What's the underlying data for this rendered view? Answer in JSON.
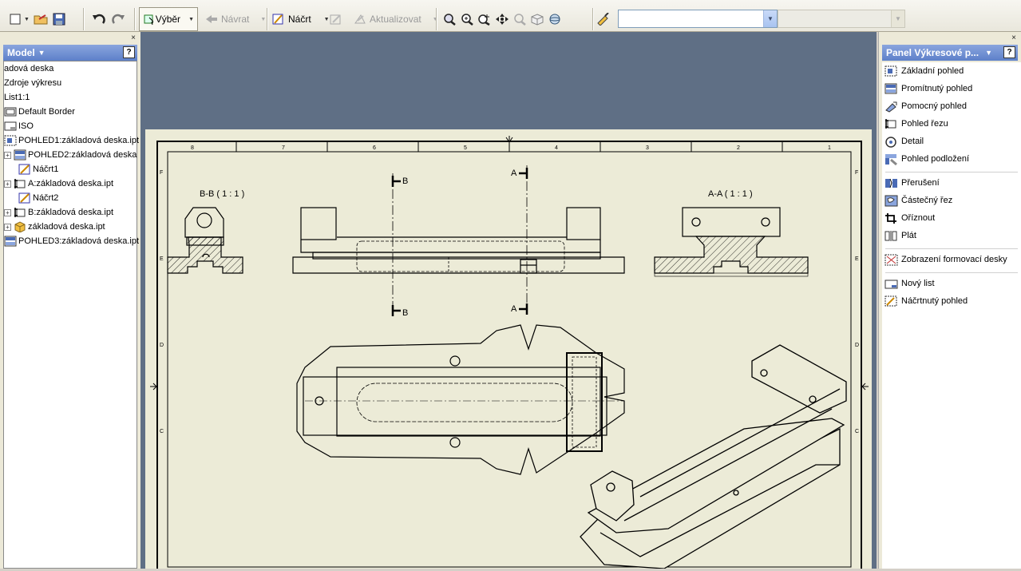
{
  "toolbar": {
    "select_label": "Výběr",
    "back_label": "Návrat",
    "sketch_label": "Náčrt",
    "update_label": "Aktualizovat",
    "dropdown_value": "",
    "dropdown2_value": ""
  },
  "model_panel": {
    "title": "Model",
    "help": "?",
    "close": "×",
    "items": [
      {
        "label": "adová deska"
      },
      {
        "label": "Zdroje výkresu"
      },
      {
        "label": "List1:1"
      },
      {
        "label": "Default Border",
        "icon": "border-icon"
      },
      {
        "label": "ISO",
        "icon": "title-block-icon"
      },
      {
        "label": "POHLED1:základová deska.ipt",
        "icon": "base-view-icon"
      },
      {
        "label": "POHLED2:základová deska",
        "icon": "projected-view-icon"
      },
      {
        "label": "Náčrt1",
        "icon": "sketch-icon"
      },
      {
        "label": "A:základová deska.ipt",
        "icon": "section-view-icon"
      },
      {
        "label": "Náčrt2",
        "icon": "sketch-icon"
      },
      {
        "label": "B:základová deska.ipt",
        "icon": "section-view-icon"
      },
      {
        "label": "základová deska.ipt",
        "icon": "part-icon"
      },
      {
        "label": "POHLED3:základová deska.ipt",
        "icon": "projected-view-icon"
      }
    ]
  },
  "right_panel": {
    "title": "Panel Výkresové p...",
    "help": "?",
    "close": "×",
    "items": [
      {
        "label": "Základní pohled",
        "icon": "base-view-icon"
      },
      {
        "label": "Promítnutý pohled",
        "icon": "projected-view-icon"
      },
      {
        "label": "Pomocný pohled",
        "icon": "auxiliary-view-icon"
      },
      {
        "label": "Pohled řezu",
        "icon": "section-view-icon"
      },
      {
        "label": "Detail",
        "icon": "detail-view-icon"
      },
      {
        "label": "Pohled podložení",
        "icon": "overlay-view-icon"
      },
      {
        "label": "Přerušení",
        "icon": "break-icon"
      },
      {
        "label": "Částečný řez",
        "icon": "break-out-icon"
      },
      {
        "label": "Oříznout",
        "icon": "crop-icon"
      },
      {
        "label": "Plát",
        "icon": "slice-icon"
      },
      {
        "label": "Zobrazení formovací desky",
        "icon": "flat-pattern-icon"
      },
      {
        "label": "Nový list",
        "icon": "new-sheet-icon"
      },
      {
        "label": "Náčrtnutý pohled",
        "icon": "draft-view-icon"
      }
    ]
  },
  "drawing": {
    "view_bb_label": "B-B ( 1 : 1 )",
    "view_aa_label": "A-A ( 1 : 1 )",
    "section_b": "B",
    "section_a": "A",
    "top_ruler": [
      "8",
      "7",
      "6",
      "5",
      "4",
      "3",
      "2",
      "1"
    ],
    "side_ruler": [
      "F",
      "E",
      "D",
      "C"
    ]
  }
}
